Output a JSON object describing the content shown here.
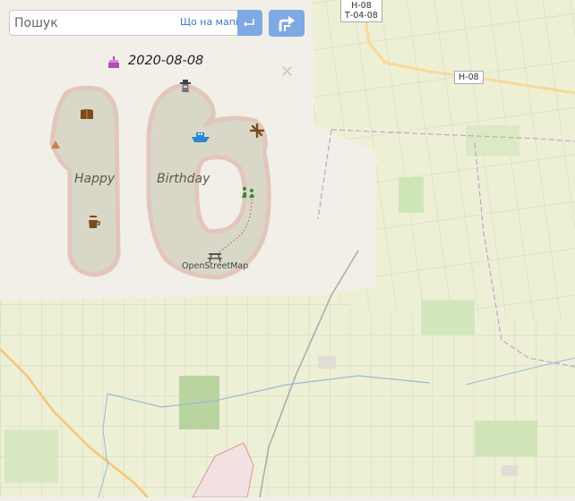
{
  "search": {
    "placeholder": "Пошук",
    "where_link": "Що на мапі?"
  },
  "road_labels": {
    "top": "Н-08",
    "top2": "Т-04-08",
    "right": "Н-08"
  },
  "easter_egg": {
    "date": "2020-08-08",
    "happy": "Happy",
    "birthday": "Birthday",
    "credit": "OpenStreetMap"
  },
  "icons": [
    "search-go-icon",
    "directions-icon",
    "cake-icon",
    "book-icon",
    "triangle-icon",
    "lighthouse-icon",
    "ferry-icon",
    "windmill-icon",
    "sitting-people-icon",
    "cafe-icon",
    "picnic-table-icon",
    "close-icon"
  ],
  "colors": {
    "button": "#7ea9e4",
    "link": "#3a78c9",
    "background": "#f2efe9",
    "farmland": "#eef0d5",
    "island": "#d9d8c8"
  }
}
